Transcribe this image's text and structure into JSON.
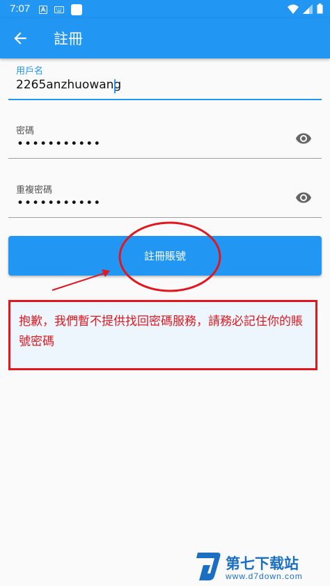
{
  "status_bar": {
    "time": "7:07"
  },
  "app_bar": {
    "title": "註冊",
    "back_icon": "arrow-left-icon"
  },
  "form": {
    "username": {
      "label": "用戶名",
      "value": "2265anzhuowang"
    },
    "password": {
      "label": "密碼",
      "value": "•••••••••••"
    },
    "confirm_password": {
      "label": "重複密碼",
      "value": "•••••••••••"
    }
  },
  "register_button": {
    "label": "註冊賬號"
  },
  "annotation": {
    "text": "抱歉，我們暫不提供找回密碼服務，請務必記住你的賬號密碼"
  },
  "watermark": {
    "name": "第七下载站",
    "url": "www.d7down.com"
  },
  "colors": {
    "primary": "#2196f3",
    "annotation_red": "#e3161d"
  }
}
